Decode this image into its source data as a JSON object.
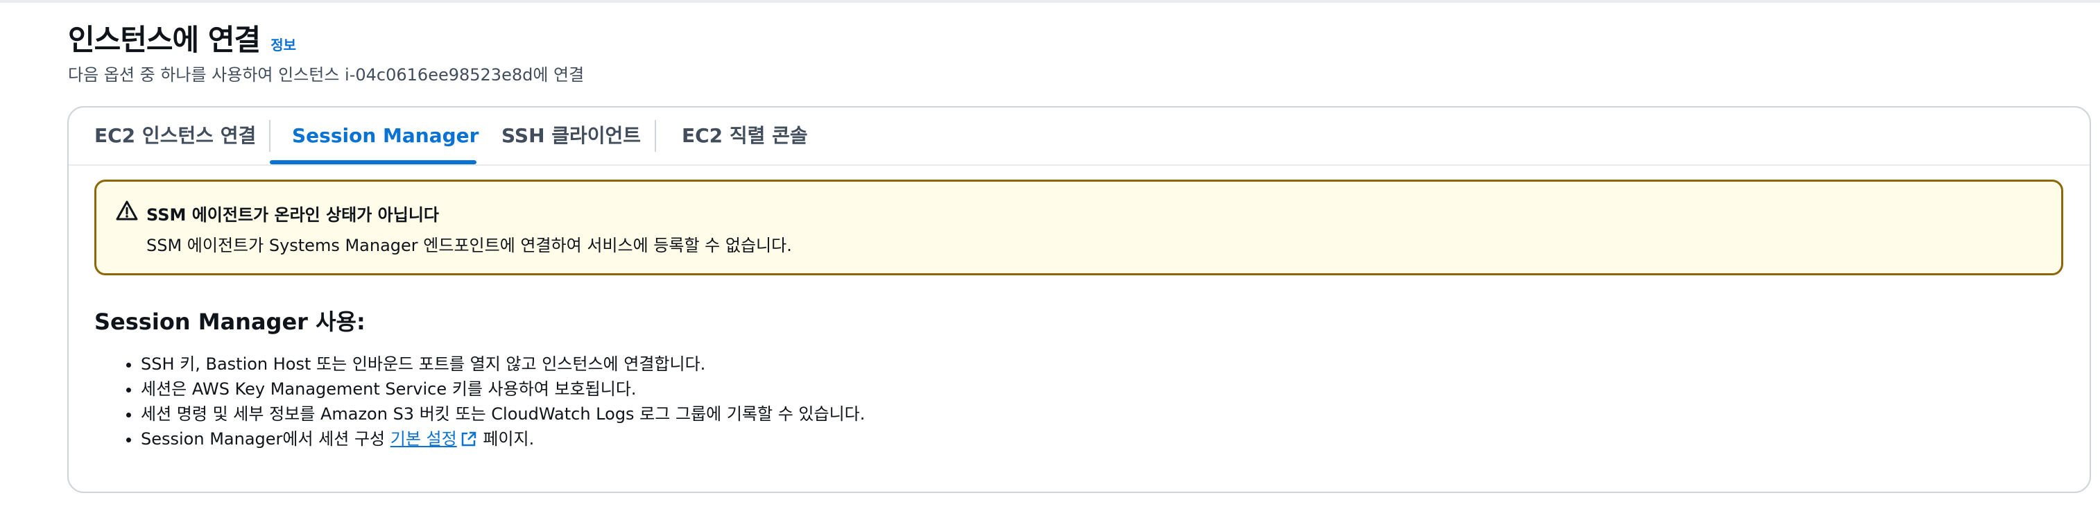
{
  "header": {
    "title": "인스턴스에 연결",
    "info_link": "정보",
    "subtitle": "다음 옵션 중 하나를 사용하여 인스턴스 i-04c0616ee98523e8d에 연결"
  },
  "tabs": [
    {
      "label": "EC2 인스턴스 연결",
      "active": false
    },
    {
      "label": "Session Manager",
      "active": true
    },
    {
      "label": "SSH 클라이언트",
      "active": false
    },
    {
      "label": "EC2 직렬 콘솔",
      "active": false
    }
  ],
  "alert": {
    "icon": "warning-icon",
    "title": "SSM 에이전트가 온라인 상태가 아닙니다",
    "body": "SSM 에이전트가 Systems Manager 엔드포인트에 연결하여 서비스에 등록할 수 없습니다."
  },
  "section": {
    "title": "Session Manager 사용:",
    "bullets": [
      "SSH 키, Bastion Host 또는 인바운드 포트를 열지 않고 인스턴스에 연결합니다.",
      "세션은 AWS Key Management Service 키를 사용하여 보호됩니다.",
      "세션 명령 및 세부 정보를 Amazon S3 버킷 또는 CloudWatch Logs 로그 그룹에 기록할 수 있습니다."
    ],
    "last_bullet": {
      "prefix": "Session Manager에서 세션 구성 ",
      "link": "기본 설정",
      "link_icon": "external-link-icon",
      "suffix": " 페이지."
    }
  },
  "colors": {
    "accent": "#0972d3",
    "warning_border": "#8d6605",
    "warning_bg": "#fffce9"
  }
}
